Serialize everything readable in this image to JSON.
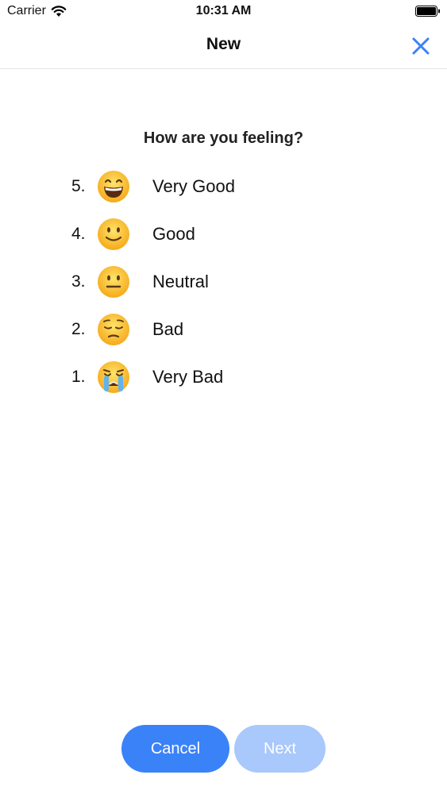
{
  "status_bar": {
    "carrier": "Carrier",
    "time": "10:31 AM",
    "icons": [
      "wifi-icon",
      "battery-icon"
    ]
  },
  "nav": {
    "title": "New",
    "close_icon": "close-icon",
    "accent_color": "#3a82f7"
  },
  "question": "How are you feeling?",
  "moods": [
    {
      "number": "5.",
      "label": "Very Good",
      "emoji": "grinning-face-icon"
    },
    {
      "number": "4.",
      "label": "Good",
      "emoji": "slightly-smiling-face-icon"
    },
    {
      "number": "3.",
      "label": "Neutral",
      "emoji": "neutral-face-icon"
    },
    {
      "number": "2.",
      "label": "Bad",
      "emoji": "pensive-face-icon"
    },
    {
      "number": "1.",
      "label": "Very Bad",
      "emoji": "crying-face-icon"
    }
  ],
  "buttons": {
    "cancel_label": "Cancel",
    "next_label": "Next",
    "cancel_color": "#3a82f7",
    "next_color": "#a9c8fb"
  }
}
